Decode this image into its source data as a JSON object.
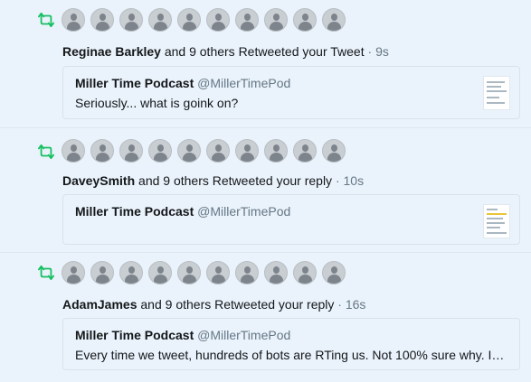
{
  "colors": {
    "retweet_green": "#17bf63",
    "background": "#eaf3fb",
    "muted": "#657786"
  },
  "notifications": [
    {
      "icon": "retweet-icon",
      "avatar_count": 10,
      "actor": "Reginae Barkley",
      "action": "and 9 others Retweeted your Tweet",
      "separator": "·",
      "time": "9s",
      "quote": {
        "name": "Miller Time Podcast",
        "handle": "@MillerTimePod",
        "text": "Seriously... what is goink on?",
        "has_thumbnail": true
      }
    },
    {
      "icon": "retweet-icon",
      "avatar_count": 10,
      "actor": "DaveySmith",
      "action": "and 9 others Retweeted your reply",
      "separator": "·",
      "time": "10s",
      "quote": {
        "name": "Miller Time Podcast",
        "handle": "@MillerTimePod",
        "text": "",
        "has_thumbnail": true
      }
    },
    {
      "icon": "retweet-icon",
      "avatar_count": 10,
      "actor": "AdamJames",
      "action": "and 9 others Retweeted your reply",
      "separator": "·",
      "time": "16s",
      "quote": {
        "name": "Miller Time Podcast",
        "handle": "@MillerTimePod",
        "text": "Every time we tweet, hundreds of bots are RTing us. Not 100% sure why. I…",
        "has_thumbnail": false
      }
    }
  ]
}
